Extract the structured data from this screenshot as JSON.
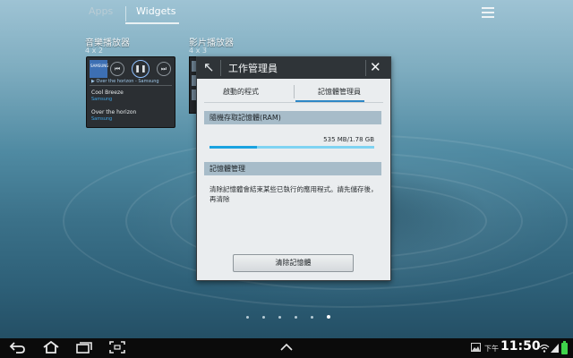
{
  "launcher": {
    "tabs": [
      {
        "label": "Apps"
      },
      {
        "label": "Widgets"
      }
    ],
    "active_tab": "Widgets"
  },
  "widgets": {
    "music": {
      "label": "音樂播放器",
      "size": "4 x 2",
      "album_text": "SAMSUNG",
      "now_playing": "Over the horizon - Samsung",
      "tracks": [
        {
          "title": "Cool Breeze",
          "artist": "Samsung"
        },
        {
          "title": "Over the horizon",
          "artist": "Samsung"
        }
      ]
    },
    "video": {
      "label": "影片播放器",
      "size": "4 x 3"
    }
  },
  "dialog": {
    "title": "工作管理員",
    "tabs": [
      "啟動的程式",
      "記憶體管理員"
    ],
    "active_tab_index": 1,
    "ram_header": "隨機存取記憶體(RAM)",
    "ram_usage": "535 MB/1.78 GB",
    "ram_used_fraction": 0.29,
    "memory_header": "記憶體管理",
    "memory_description": "清除記憶體會結束某些已執行的應用程式。請先儲存後，再清除",
    "clear_button": "清除記憶體"
  },
  "page_indicator": {
    "count": 6,
    "active_index": 5
  },
  "statusbar": {
    "ampm": "下午",
    "time": "11:50"
  },
  "colors": {
    "dialog_header": "#2f3438",
    "tab_indicator": "#2f88c6",
    "section_header": "#a7bcc9",
    "progress_track": "#7fd3f2",
    "progress_fill": "#1aa3e0",
    "battery": "#3fd34a"
  },
  "icons": {
    "back": "back-icon",
    "home": "home-icon",
    "recent": "recent-apps-icon",
    "screenshot": "screenshot-icon",
    "up": "chevron-up-icon",
    "gallery": "gallery-notification-icon",
    "wifi": "wifi-icon",
    "signal": "signal-icon",
    "battery": "battery-icon"
  }
}
